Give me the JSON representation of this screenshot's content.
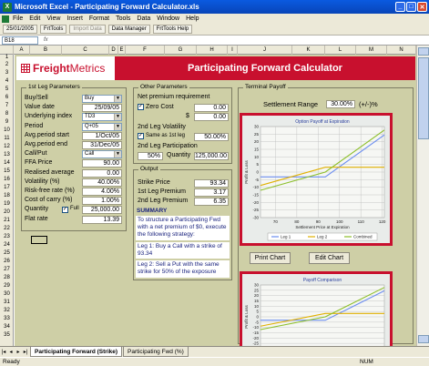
{
  "window": {
    "title": "Microsoft Excel - Participating Forward Calculator.xls"
  },
  "menu": [
    "File",
    "Edit",
    "View",
    "Insert",
    "Format",
    "Tools",
    "Data",
    "Window",
    "Help"
  ],
  "toolbar": {
    "date": "25/01/2005",
    "fm_tools": "FrtTools",
    "import_data": "Import Data",
    "data_manager": "Data Manager",
    "frt_tools_help": "FrtTools Help"
  },
  "formula": {
    "name_box": "B18"
  },
  "columns": [
    "A",
    "B",
    "C",
    "D",
    "E",
    "F",
    "G",
    "H",
    "I",
    "J",
    "K",
    "L",
    "M",
    "N"
  ],
  "rows": [
    "1",
    "2",
    "3",
    "4",
    "5",
    "6",
    "7",
    "8",
    "9",
    "10",
    "11",
    "12",
    "13",
    "14",
    "15",
    "16",
    "17",
    "18",
    "19",
    "20",
    "21",
    "22",
    "23",
    "24",
    "25",
    "26",
    "27",
    "28",
    "29",
    "30",
    "31",
    "32",
    "33",
    "34",
    "35",
    "36"
  ],
  "banner": {
    "logo": "FreightMetrics",
    "logo_a": "Freight",
    "logo_b": "Metrics",
    "title": "Participating Forward Calculator"
  },
  "first_leg": {
    "group_label": "1st Leg Parameters",
    "fields": [
      {
        "label": "Buy/Sell",
        "value": "Buy",
        "type": "select"
      },
      {
        "label": "Value date",
        "value": "25/09/05",
        "type": "text"
      },
      {
        "label": "Underlying index",
        "value": "TD3",
        "type": "select"
      },
      {
        "label": "Period",
        "value": "Q+05",
        "type": "select"
      },
      {
        "label": "Avg.period start",
        "value": "1/Oct/05",
        "type": "text"
      },
      {
        "label": "Avg.period end",
        "value": "31/Dec/05",
        "type": "text"
      },
      {
        "label": "Call/Put",
        "value": "Call",
        "type": "select"
      },
      {
        "label": "FFA Price",
        "value": "90.00",
        "type": "num"
      },
      {
        "label": "Realised average",
        "value": "0.00",
        "type": "num"
      },
      {
        "label": "Volatility (%)",
        "value": "40.00%",
        "type": "num"
      },
      {
        "label": "Risk-free rate (%)",
        "value": "4.00%",
        "type": "num"
      },
      {
        "label": "Cost of carry (%)",
        "value": "1.00%",
        "type": "num"
      },
      {
        "label": "Quantity",
        "value": "25,000.00",
        "type": "qty",
        "check_label": "Full"
      },
      {
        "label": "Flat rate",
        "value": "13.39",
        "type": "num"
      }
    ]
  },
  "other": {
    "group_label": "Other Parameters",
    "net_premium_label": "Net premium requirement",
    "zero_cost_label": "Zero Cost",
    "zero_cost_value": "0.00",
    "dollar": "$",
    "dollar_value": "0.00",
    "vol2_label": "2nd Leg Volatility",
    "same_as_label": "Same as 1st leg",
    "vol2_value": "50.00%",
    "participation_label": "2nd Leg Participation",
    "participation_value": "50%",
    "quantity_label": "Quantity",
    "quantity_value": "125,000.00"
  },
  "output": {
    "group_label": "Output",
    "rows": [
      {
        "label": "Strike Price",
        "value": "93.34"
      },
      {
        "label": "1st Leg Premium",
        "value": "3.17"
      },
      {
        "label": "2nd Leg Premium",
        "value": "6.35"
      }
    ],
    "summary_title": "SUMMARY",
    "summary_1": "To structure a Participating Fwd with a net premium of $0, execute the following strategy:",
    "summary_2": "Leg 1: Buy a Call with a strike of 93.34",
    "summary_3": "Leg 2: Sell a Put with the same strike for 50% of the exposure"
  },
  "terminal": {
    "group_label": "Terminal Payoff",
    "settlement_label": "Settlement Range",
    "settlement_value": "30.00%",
    "settlement_unit": "(+/-)%",
    "print_chart": "Print Chart",
    "edit_chart": "Edit Chart"
  },
  "chart_data": [
    {
      "type": "line",
      "title": "Option Payoff at Expiration",
      "xlabel": "Settlement Price at Expiration",
      "ylabel": "Profit & Loss",
      "xlim": [
        63,
        121
      ],
      "ylim": [
        -30,
        30
      ],
      "x_ticks": [
        70,
        80,
        90,
        100,
        110,
        120
      ],
      "y_ticks": [
        -30,
        -25,
        -20,
        -15,
        -10,
        -5,
        0,
        5,
        10,
        15,
        20,
        25,
        30
      ],
      "x": [
        63,
        93.34,
        121
      ],
      "series": [
        {
          "name": "Leg 1",
          "color": "#6c8ef0",
          "values": [
            -3.17,
            -3.17,
            24.5
          ]
        },
        {
          "name": "Leg 2",
          "color": "#e0b000",
          "values": [
            -8.8,
            3.17,
            3.17
          ]
        },
        {
          "name": "Combined",
          "color": "#8cbf2a",
          "values": [
            -12.0,
            0,
            27.7
          ]
        }
      ],
      "grid": true,
      "legend": "bottom"
    },
    {
      "type": "line",
      "title": "Payoff Comparison",
      "ylabel": "Profit & Loss",
      "ylim": [
        -30,
        30
      ],
      "y_ticks": [
        -30,
        -25,
        -20,
        -15,
        -10,
        -5,
        0,
        5,
        10,
        15,
        20,
        25,
        30
      ],
      "series": [
        {
          "color": "#6c8ef0",
          "values": [
            -3.17,
            -3.17,
            24.5
          ]
        },
        {
          "color": "#e0b000",
          "values": [
            -8.8,
            3.17,
            3.17
          ]
        },
        {
          "color": "#8cbf2a",
          "values": [
            -12.0,
            0,
            27.7
          ]
        }
      ],
      "grid": true
    }
  ],
  "sheet_tabs": [
    "Participating Forward (Strike)",
    "Participating Fwd (%)"
  ],
  "status": {
    "left": "Ready",
    "right": "NUM"
  }
}
